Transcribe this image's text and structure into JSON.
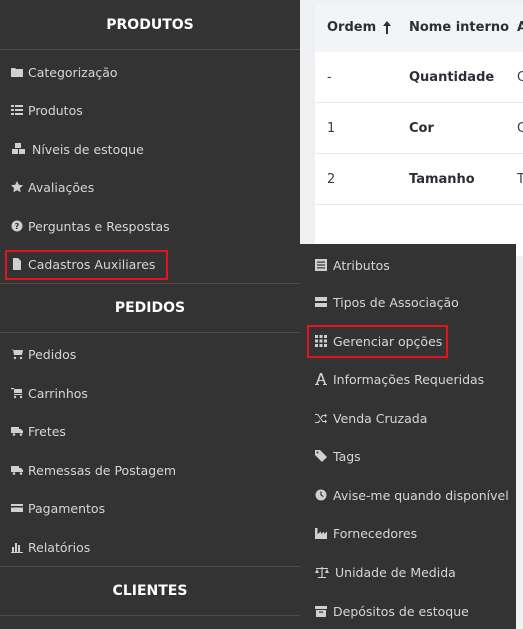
{
  "sidebar": {
    "sections": [
      {
        "title": "PRODUTOS"
      },
      {
        "title": "PEDIDOS"
      },
      {
        "title": "CLIENTES"
      }
    ],
    "produtos_items": [
      {
        "label": "Categorização",
        "icon": "folder-icon"
      },
      {
        "label": "Produtos",
        "icon": "list-icon"
      },
      {
        "label": "Níveis de estoque",
        "icon": "cubes-icon"
      },
      {
        "label": "Avaliações",
        "icon": "star-icon"
      },
      {
        "label": "Perguntas e Respostas",
        "icon": "question-circle-icon"
      },
      {
        "label": "Cadastros Auxiliares",
        "icon": "file-icon"
      }
    ],
    "pedidos_items": [
      {
        "label": "Pedidos",
        "icon": "cart-icon"
      },
      {
        "label": "Carrinhos",
        "icon": "cart-icon"
      },
      {
        "label": "Fretes",
        "icon": "truck-icon"
      },
      {
        "label": "Remessas de Postagem",
        "icon": "truck-icon"
      },
      {
        "label": "Pagamentos",
        "icon": "credit-card-icon"
      },
      {
        "label": "Relatórios",
        "icon": "bar-chart-icon"
      }
    ]
  },
  "submenu": {
    "items": [
      {
        "label": "Atributos",
        "icon": "list-alt-icon"
      },
      {
        "label": "Tipos de Associação",
        "icon": "server-icon"
      },
      {
        "label": "Gerenciar opções",
        "icon": "grid-icon"
      },
      {
        "label": "Informações Requeridas",
        "icon": "font-icon"
      },
      {
        "label": "Venda Cruzada",
        "icon": "random-icon"
      },
      {
        "label": "Tags",
        "icon": "tag-icon"
      },
      {
        "label": "Avise-me quando disponível",
        "icon": "clock-icon"
      },
      {
        "label": "Fornecedores",
        "icon": "industry-icon"
      },
      {
        "label": "Unidade de Medida",
        "icon": "balance-scale-icon"
      },
      {
        "label": "Depósitos de estoque",
        "icon": "archive-icon"
      }
    ]
  },
  "table": {
    "headers": [
      "Ordem",
      "Nome interno",
      "A"
    ],
    "sort_icon": "arrow-up-icon",
    "rows": [
      {
        "ordem": "-",
        "nome": "Quantidade",
        "extra": "Q"
      },
      {
        "ordem": "1",
        "nome": "Cor",
        "extra": "C"
      },
      {
        "ordem": "2",
        "nome": "Tamanho",
        "extra": "T"
      }
    ]
  },
  "colors": {
    "sidebar_bg": "#333333",
    "highlight": "#e3141b",
    "text": "#d6d6d6"
  }
}
